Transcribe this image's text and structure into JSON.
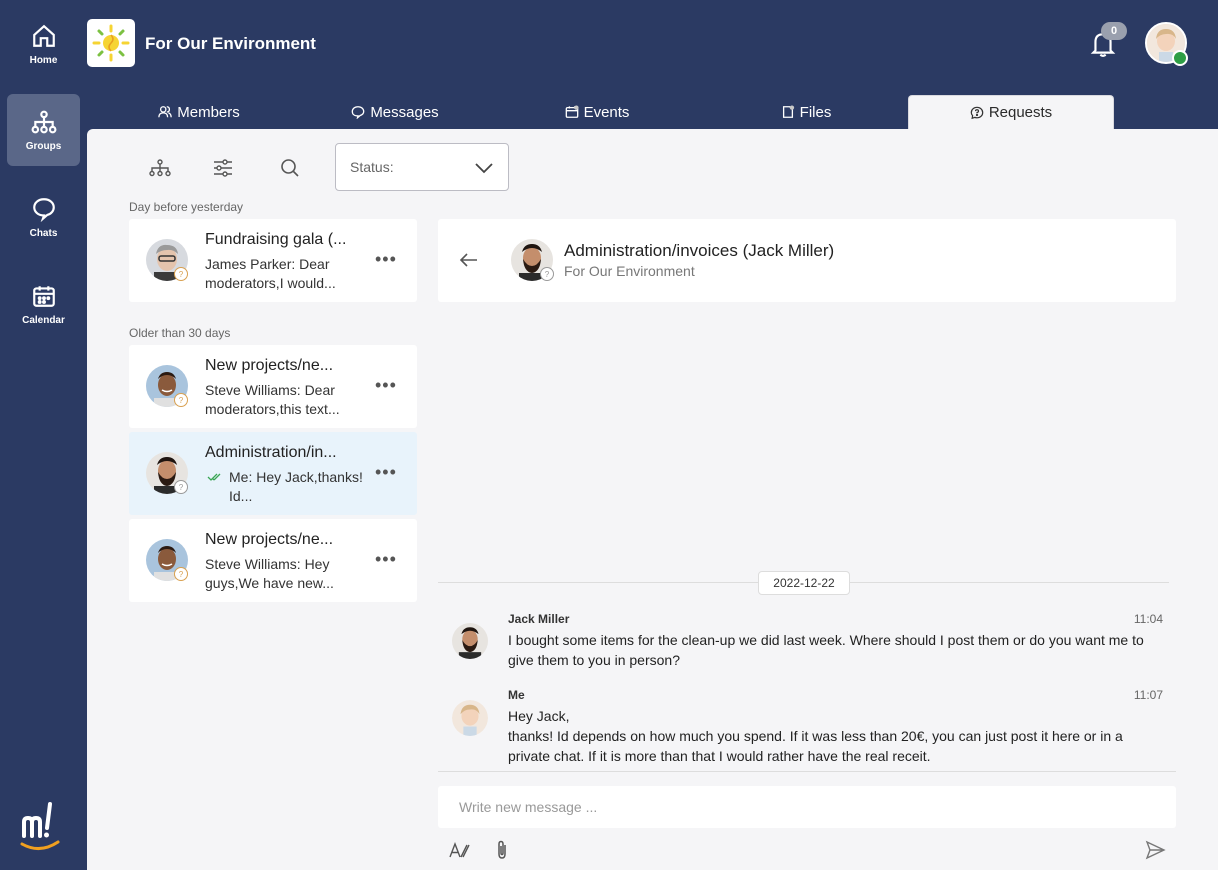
{
  "rail": {
    "items": [
      {
        "label": "Home",
        "icon": "home-icon"
      },
      {
        "label": "Groups",
        "icon": "groups-icon"
      },
      {
        "label": "Chats",
        "icon": "chat-icon"
      },
      {
        "label": "Calendar",
        "icon": "calendar-icon"
      }
    ]
  },
  "header": {
    "group_name": "For Our Environment",
    "notification_count": "0"
  },
  "tabs": [
    {
      "label": "Members",
      "icon": "members-icon"
    },
    {
      "label": "Messages",
      "icon": "message-icon"
    },
    {
      "label": "Events",
      "icon": "events-icon"
    },
    {
      "label": "Files",
      "icon": "files-icon"
    },
    {
      "label": "Requests",
      "icon": "requests-icon"
    }
  ],
  "filters": {
    "status_label": "Status:"
  },
  "sections": {
    "recent": "Day before yesterday",
    "older": "Older than 30 days"
  },
  "requests": [
    {
      "title": "Fundraising gala (...",
      "snippet": "James Parker: Dear moderators,I would..."
    },
    {
      "title": "New projects/ne...",
      "snippet": "Steve Williams: Dear moderators,this text..."
    },
    {
      "title": "Administration/in...",
      "snippet": "Me: Hey Jack,thanks! Id..."
    },
    {
      "title": "New projects/ne...",
      "snippet": "Steve Williams: Hey guys,We have new..."
    }
  ],
  "chat": {
    "title": "Administration/invoices (Jack Miller)",
    "subtitle": "For Our Environment",
    "date": "2022-12-22",
    "messages": [
      {
        "author": "Jack Miller",
        "time": "11:04",
        "text": "I bought some items for the clean-up we did last week. Where should I post them or do you want me to give them to you in person?"
      },
      {
        "author": "Me",
        "time": "11:07",
        "text_line1": "Hey Jack,",
        "text_line2": "thanks! Id depends on how much you spend. If it was less than 20€, you can just post it here or in a private chat. If it is more than that I would rather have the real receit."
      }
    ],
    "compose_placeholder": "Write new message ..."
  },
  "colors": {
    "sidebar_bg": "#2b3a63",
    "content_bg": "#f5f5f7",
    "selected_card": "#e8f3fb",
    "online": "#2e9e45",
    "pending_badge": "#d8a050"
  }
}
